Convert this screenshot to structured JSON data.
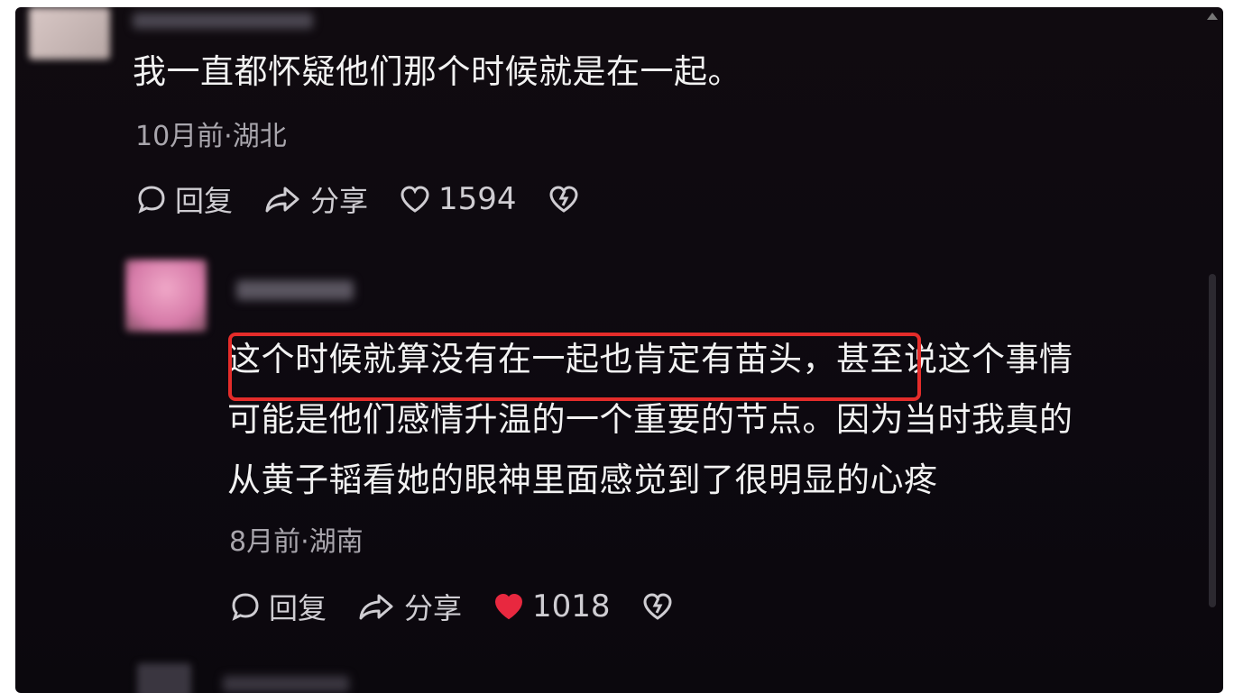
{
  "comment1": {
    "text": "我一直都怀疑他们那个时候就是在一起。",
    "meta": "10月前·湖北",
    "reply_label": "回复",
    "share_label": "分享",
    "like_count": "1594"
  },
  "comment2": {
    "lines": [
      "这个时候就算没有在一起也肯定有苗头，甚至说这个事情",
      "可能是他们感情升温的一个重要的节点。因为当时我真的",
      "从黄子韬看她的眼神里面感觉到了很明显的心疼"
    ],
    "meta": "8月前·湖南",
    "reply_label": "回复",
    "share_label": "分享",
    "like_count": "1018",
    "liked": true
  },
  "colors": {
    "background": "#0d0910",
    "liked_heart": "#e8283f",
    "highlight_box": "#e42c2a"
  },
  "icons": [
    "comment-icon",
    "share-icon",
    "heart-icon",
    "dislike-icon"
  ]
}
